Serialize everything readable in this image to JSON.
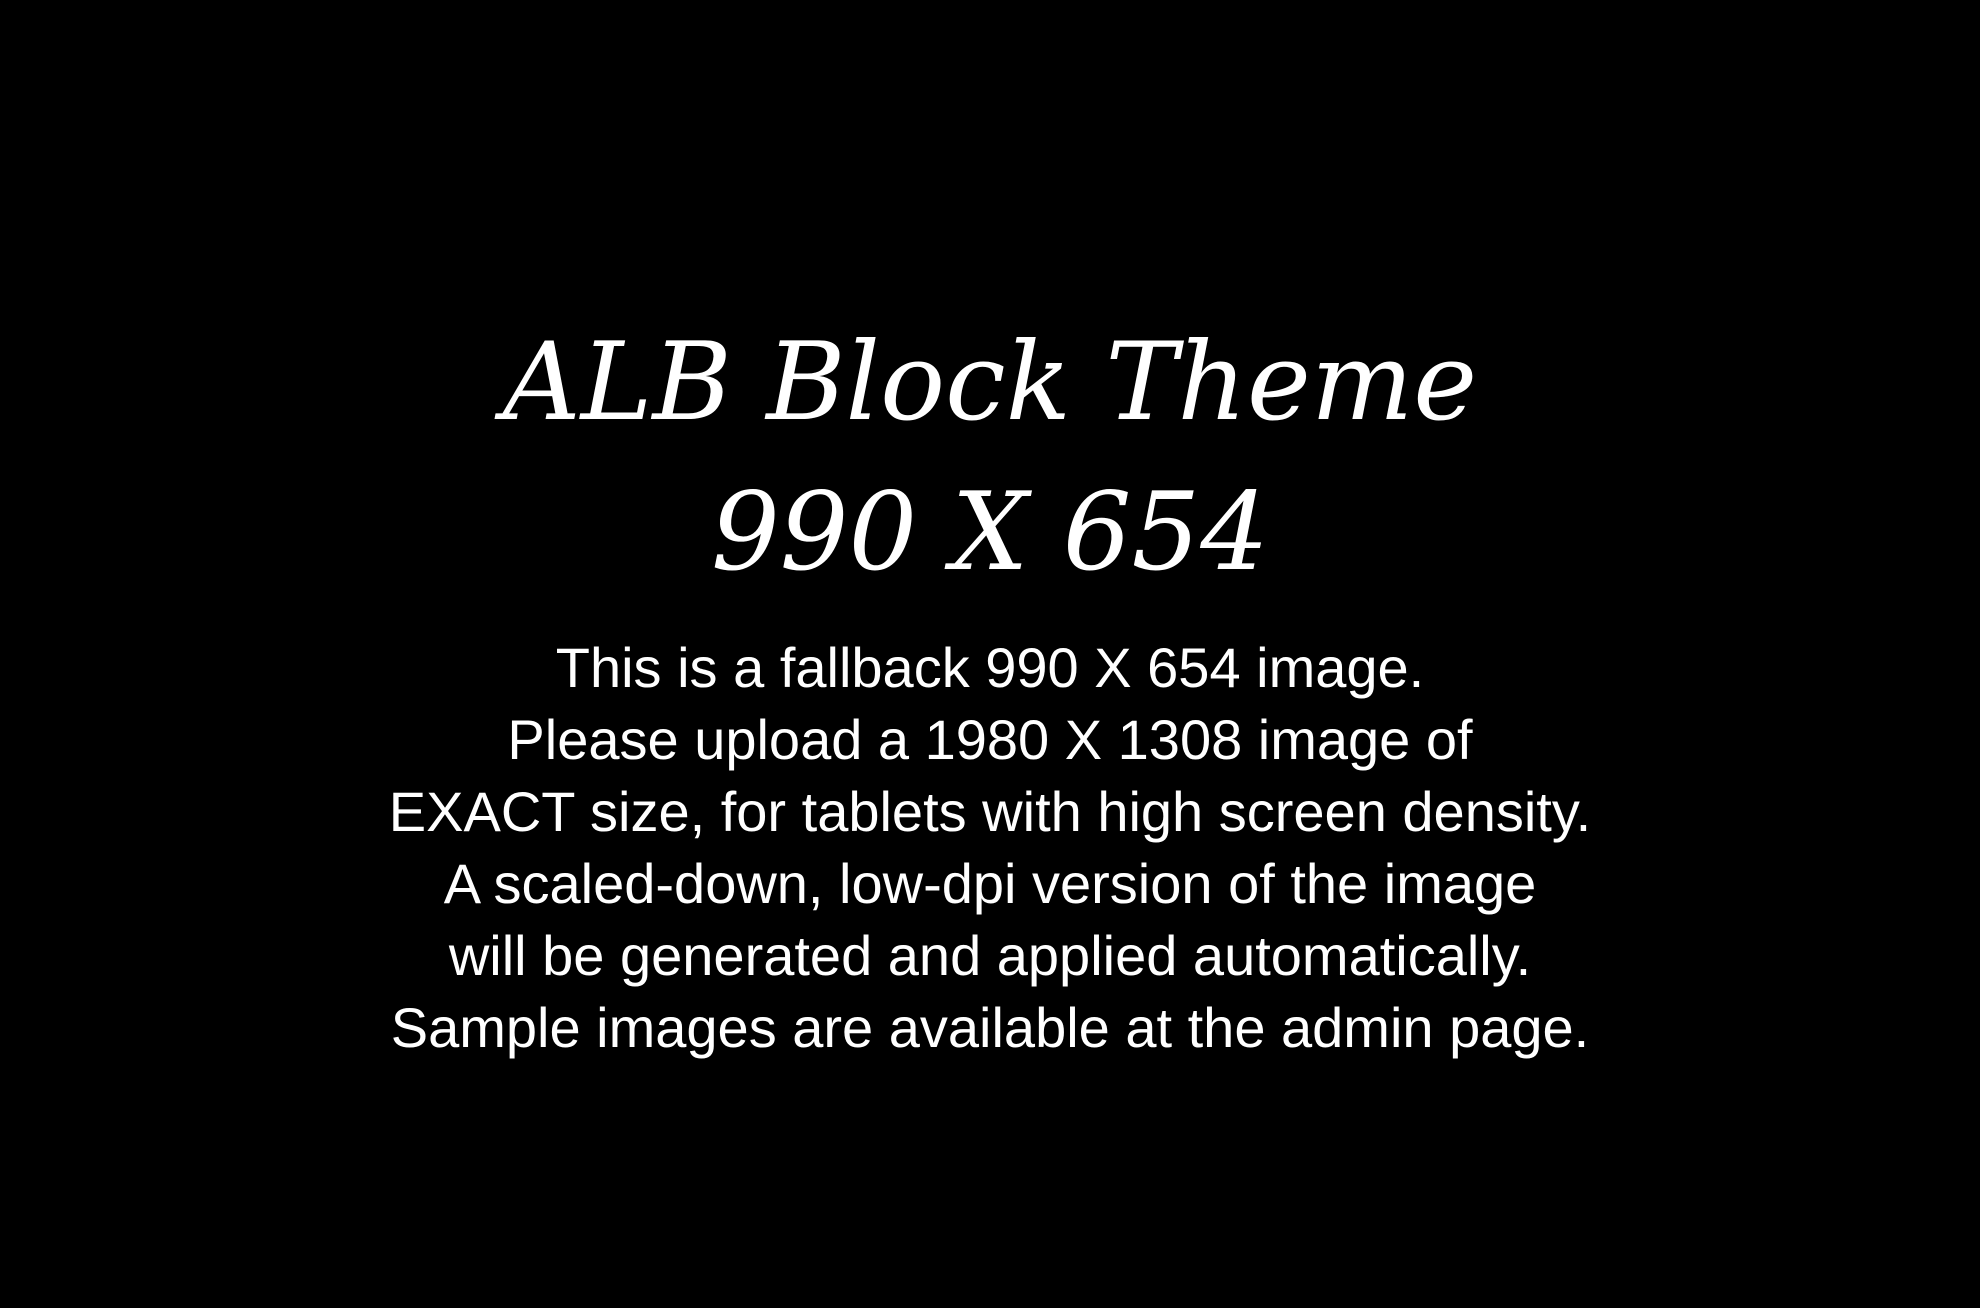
{
  "placeholder": {
    "title": "ALB Block Theme",
    "dimensions": "990 X 654",
    "lines": [
      "This is a fallback 990 X 654 image.",
      "Please upload a 1980 X 1308 image of",
      "EXACT size, for tablets with high screen density.",
      "A scaled-down, low-dpi version of the image",
      "will be generated and applied automatically.",
      "Sample images are available at the admin page."
    ]
  },
  "colors": {
    "background": "#000000",
    "text": "#ffffff"
  }
}
